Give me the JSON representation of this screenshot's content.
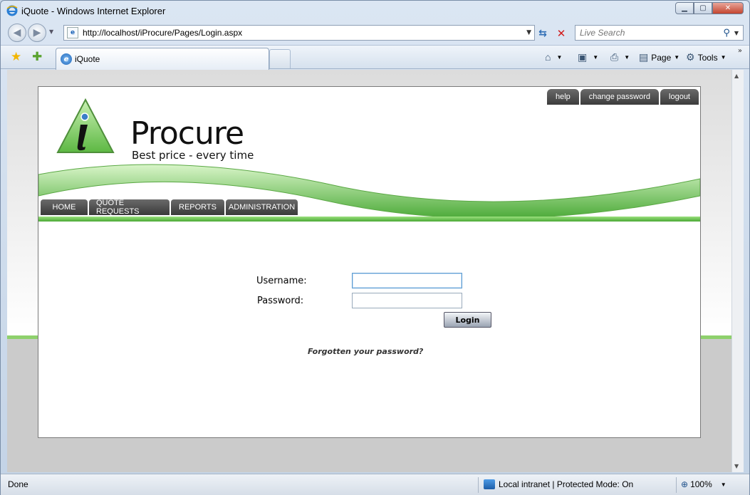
{
  "window": {
    "title": "iQuote - Windows Internet Explorer"
  },
  "address": {
    "url": "http://localhost/iProcure/Pages/Login.aspx"
  },
  "search": {
    "placeholder": "Live Search"
  },
  "tab": {
    "label": "iQuote"
  },
  "commands": {
    "page": "Page",
    "tools": "Tools"
  },
  "site": {
    "brand": "Procure",
    "brand_letter": "i",
    "tagline": "Best price - every time",
    "top_links": [
      "help",
      "change password",
      "logout"
    ],
    "nav": [
      "HOME",
      "QUOTE REQUESTS",
      "REPORTS",
      "ADMINISTRATION"
    ]
  },
  "login": {
    "username_label": "Username:",
    "password_label": "Password:",
    "username_value": "",
    "password_value": "",
    "button": "Login",
    "forgot": "Forgotten your password?"
  },
  "status": {
    "left": "Done",
    "zone": "Local intranet | Protected Mode: On",
    "zoom": "100%"
  },
  "colors": {
    "accent_green": "#8ed06c",
    "nav_dark": "#444444"
  }
}
